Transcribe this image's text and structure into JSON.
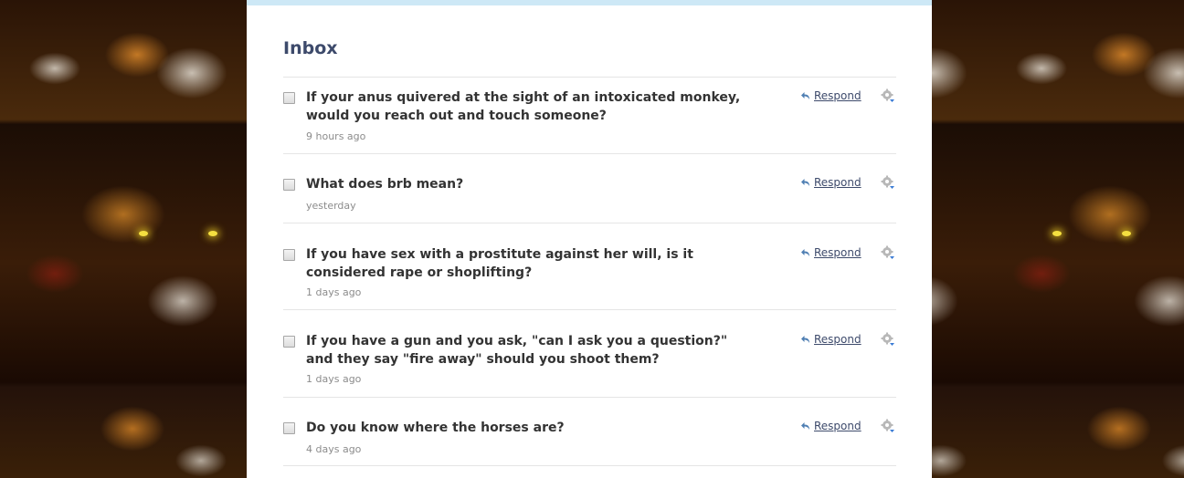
{
  "inbox": {
    "title": "Inbox",
    "respond_label": "Respond",
    "items": [
      {
        "question": "If your anus quivered at the sight of an intoxicated monkey, would you reach out and touch someone?",
        "time": "9 hours ago"
      },
      {
        "question": "What does brb mean?",
        "time": "yesterday"
      },
      {
        "question": "If you have sex with a prostitute against her will, is it considered rape or shoplifting?",
        "time": "1 days ago"
      },
      {
        "question": "If you have a gun and you ask, \"can I ask you a question?\" and they say \"fire away\" should you shoot them?",
        "time": "1 days ago"
      },
      {
        "question": "Do you know where the horses are?",
        "time": "4 days ago"
      }
    ]
  },
  "colors": {
    "panel_top_border": "#cde8f6",
    "title": "#3d4a6b",
    "question_text": "#333333",
    "timestamp": "#8c8c8c",
    "link": "#3d4a6b"
  },
  "icons": {
    "respond": "reply-arrow-icon",
    "options": "gear-icon"
  }
}
